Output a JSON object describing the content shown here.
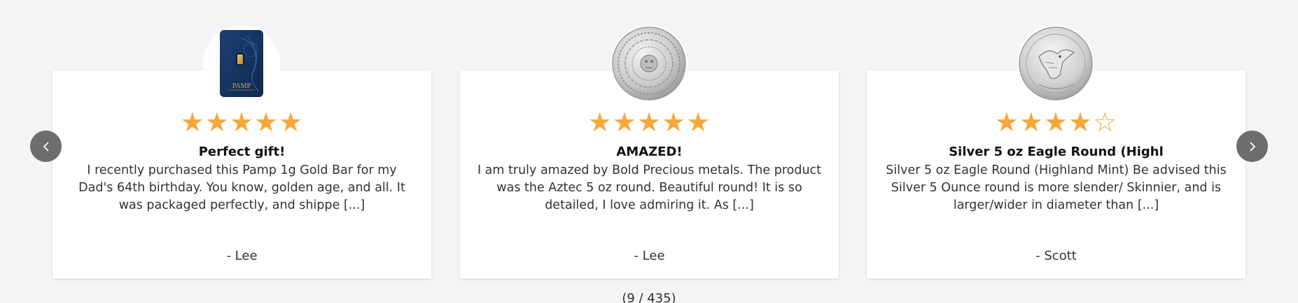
{
  "colors": {
    "star": "#f5a83a",
    "nav_button": "#6d6d6d",
    "background": "#f4f4f4"
  },
  "navigation": {
    "prev_icon": "chevron-left-icon",
    "next_icon": "chevron-right-icon"
  },
  "reviews": [
    {
      "product_image": "pamp-gold-bar-icon",
      "rating": 5,
      "title": "Perfect gift!",
      "body": "I recently purchased this Pamp 1g Gold Bar for my Dad's 64th birthday. You know, golden age, and all. It was packaged perfectly, and shippe [...]",
      "author": "- Lee",
      "image_brand_text": "PAMP"
    },
    {
      "product_image": "aztec-silver-round-icon",
      "rating": 5,
      "title": "AMAZED!",
      "body": "I am truly amazed by Bold Precious metals. The product was the Aztec 5 oz round. Beautiful round! It is so detailed, I love admiring it. As [...]",
      "author": "- Lee"
    },
    {
      "product_image": "silver-eagle-round-icon",
      "rating": 4,
      "title": "Silver 5 oz Eagle Round (Highl",
      "body": "Silver 5 oz Eagle Round (Highland Mint) Be advised this Silver 5 Ounce round is more slender/ Skinnier, and is larger/wider in diameter than [...]",
      "author": "- Scott"
    }
  ],
  "counter": "(9 / 435)"
}
